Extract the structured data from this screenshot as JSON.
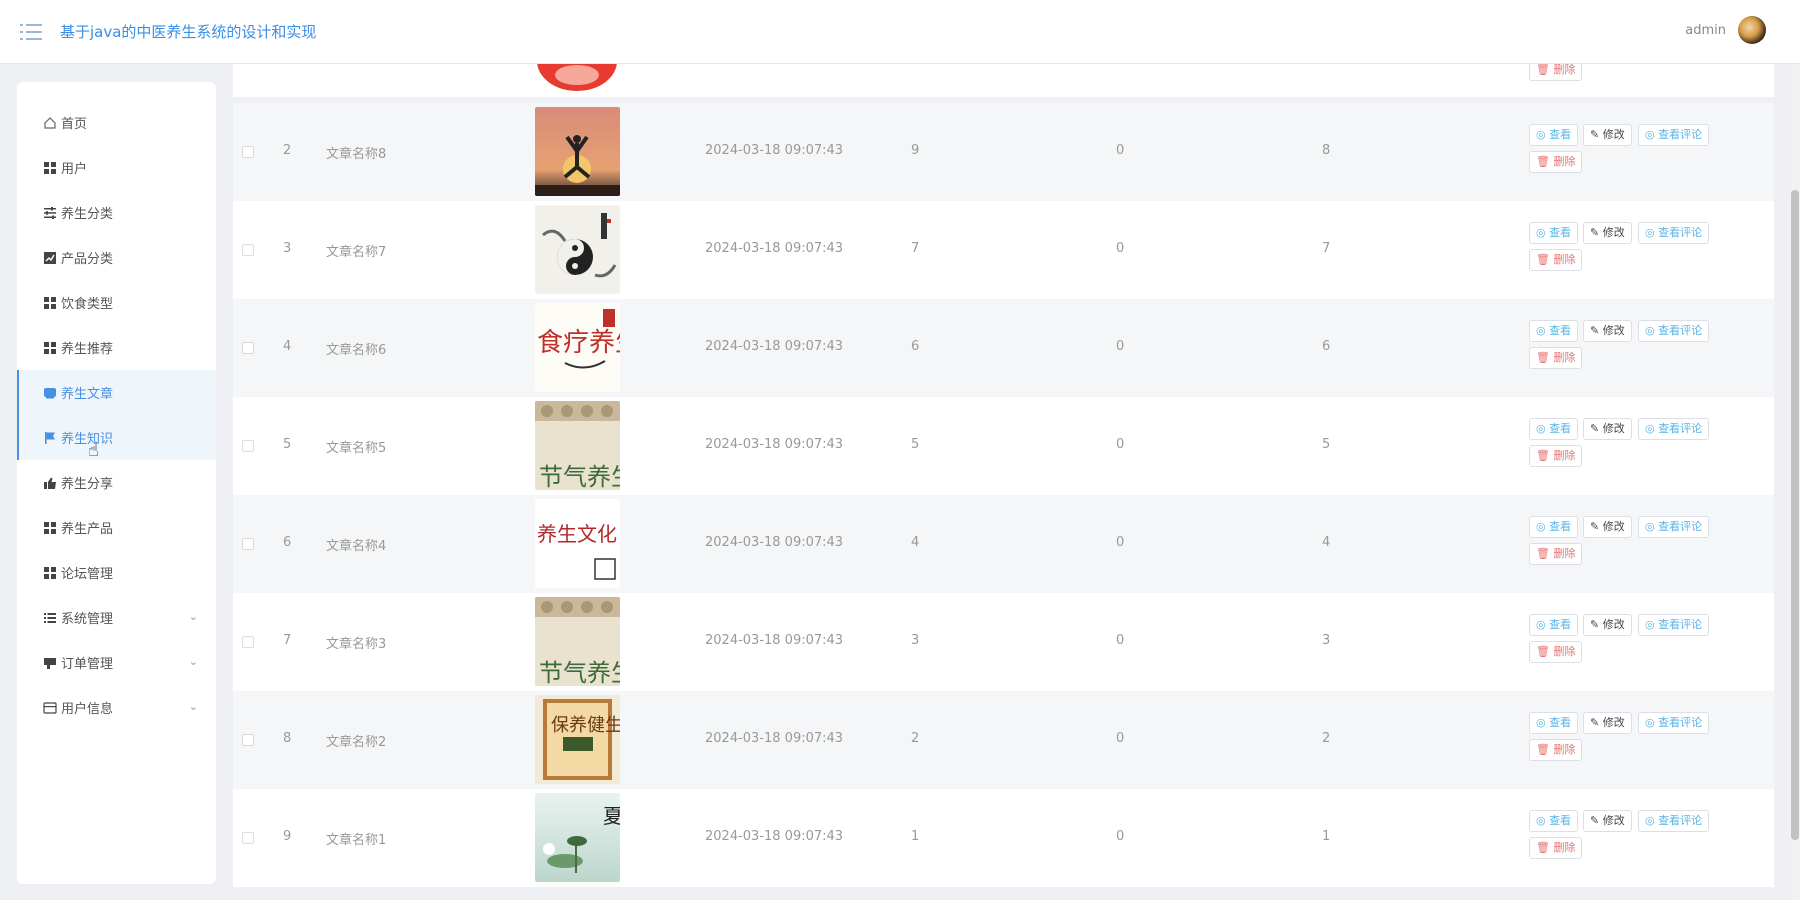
{
  "header": {
    "title": "基于java的中医养生系统的设计和实现",
    "username": "admin"
  },
  "sidebar": {
    "items": [
      {
        "label": "首页",
        "icon": "home-icon"
      },
      {
        "label": "用户",
        "icon": "grid-icon"
      },
      {
        "label": "养生分类",
        "icon": "sliders-icon"
      },
      {
        "label": "产品分类",
        "icon": "chart-icon"
      },
      {
        "label": "饮食类型",
        "icon": "grid-icon"
      },
      {
        "label": "养生推荐",
        "icon": "grid-icon"
      },
      {
        "label": "养生文章",
        "icon": "message-icon",
        "active": true
      },
      {
        "label": "养生知识",
        "icon": "flag-icon",
        "active": true
      },
      {
        "label": "养生分享",
        "icon": "share-icon"
      },
      {
        "label": "养生产品",
        "icon": "grid-icon"
      },
      {
        "label": "论坛管理",
        "icon": "grid-icon"
      },
      {
        "label": "系统管理",
        "icon": "list-icon",
        "expandable": true
      },
      {
        "label": "订单管理",
        "icon": "order-icon",
        "expandable": true
      },
      {
        "label": "用户信息",
        "icon": "card-icon",
        "expandable": true
      }
    ]
  },
  "table": {
    "partial_top_row": {
      "delete_label": "删除"
    },
    "rows": [
      {
        "idx": "2",
        "name": "文章名称8",
        "time": "2024-03-18 09:07:43",
        "a": "9",
        "b": "0",
        "c": "8",
        "image": "yoga-sunset-image"
      },
      {
        "idx": "3",
        "name": "文章名称7",
        "time": "2024-03-18 09:07:43",
        "a": "7",
        "b": "0",
        "c": "7",
        "image": "ink-taichi-image"
      },
      {
        "idx": "4",
        "name": "文章名称6",
        "time": "2024-03-18 09:07:43",
        "a": "6",
        "b": "0",
        "c": "6",
        "image": "food-therapy-calligraphy-image",
        "image_text": "食疗养生"
      },
      {
        "idx": "5",
        "name": "文章名称5",
        "time": "2024-03-18 09:07:43",
        "a": "5",
        "b": "0",
        "c": "5",
        "image": "seasonal-health-image",
        "image_text": "节气养生"
      },
      {
        "idx": "6",
        "name": "文章名称4",
        "time": "2024-03-18 09:07:43",
        "a": "4",
        "b": "0",
        "c": "4",
        "image": "health-culture-image",
        "image_text": "养生文化"
      },
      {
        "idx": "7",
        "name": "文章名称3",
        "time": "2024-03-18 09:07:43",
        "a": "3",
        "b": "0",
        "c": "3",
        "image": "seasonal-health-image",
        "image_text": "节气养生"
      },
      {
        "idx": "8",
        "name": "文章名称2",
        "time": "2024-03-18 09:07:43",
        "a": "2",
        "b": "0",
        "c": "2",
        "image": "health-book-image",
        "image_text": "保养健生"
      },
      {
        "idx": "9",
        "name": "文章名称1",
        "time": "2024-03-18 09:07:43",
        "a": "1",
        "b": "0",
        "c": "1",
        "image": "lotus-summer-image",
        "image_text": "夏"
      }
    ],
    "buttons": {
      "view": "查看",
      "edit": "修改",
      "comment": "查看评论",
      "delete": "删除"
    }
  },
  "colors": {
    "accent": "#4a90e2",
    "link": "#5ab4e6",
    "danger": "#e57373"
  }
}
